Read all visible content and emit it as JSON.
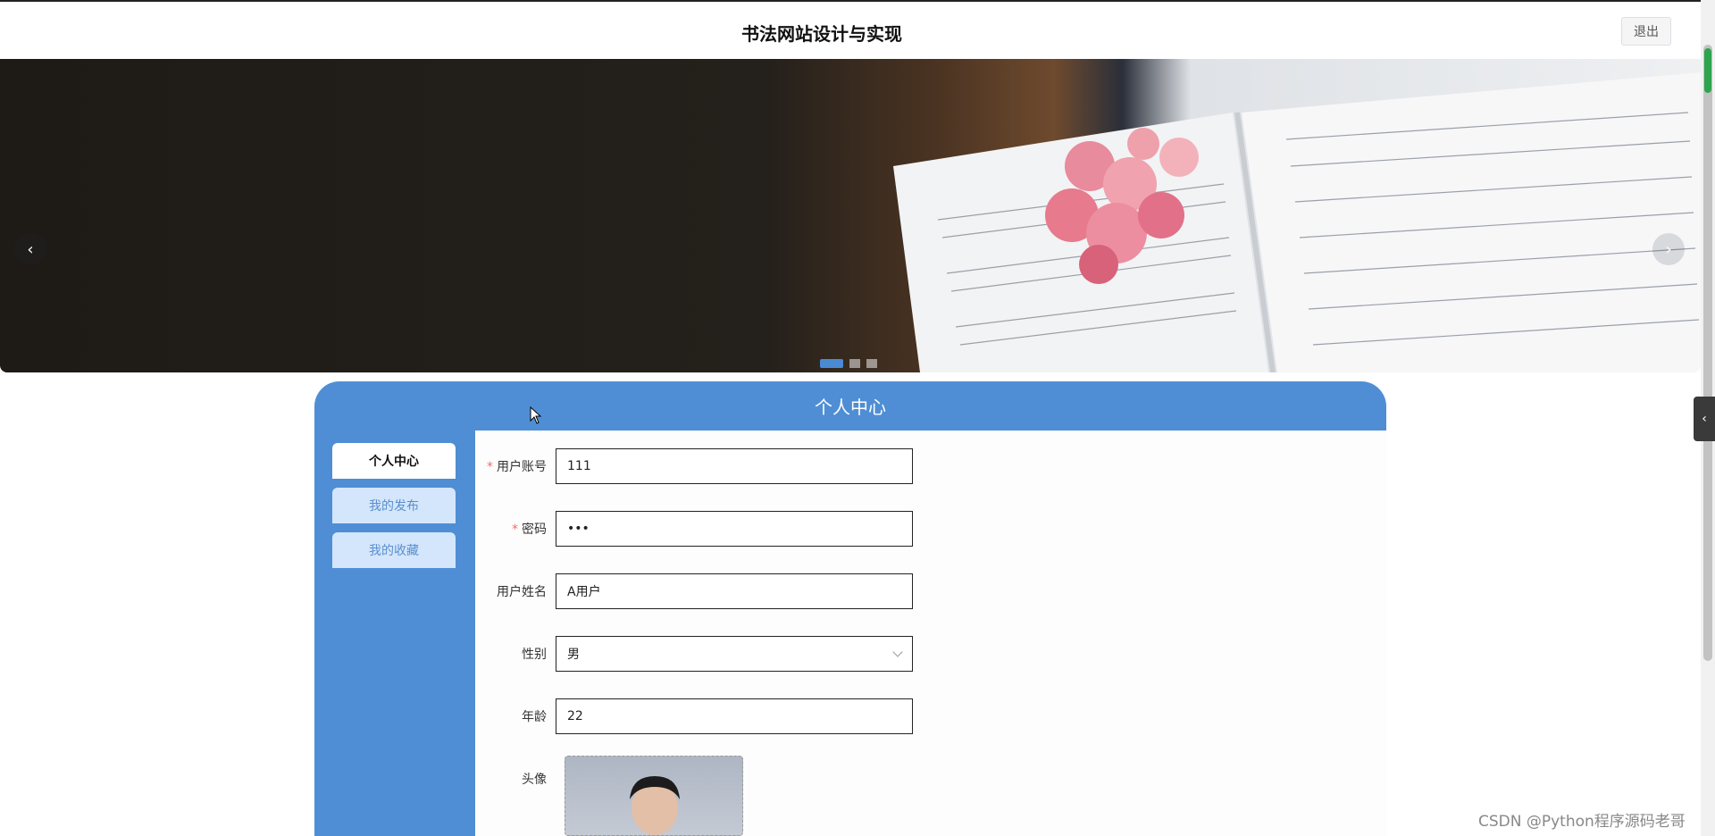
{
  "header": {
    "title": "书法网站设计与实现",
    "logout_label": "退出"
  },
  "banner": {
    "prev_label": "‹",
    "next_label": "›"
  },
  "panel": {
    "title": "个人中心"
  },
  "sidebar": {
    "items": [
      {
        "label": "个人中心"
      },
      {
        "label": "我的发布"
      },
      {
        "label": "我的收藏"
      }
    ]
  },
  "form": {
    "account": {
      "label": "用户账号",
      "value": "111"
    },
    "password": {
      "label": "密码",
      "value": "•••"
    },
    "name": {
      "label": "用户姓名",
      "value": "A用户"
    },
    "gender": {
      "label": "性别",
      "value": "男"
    },
    "age": {
      "label": "年龄",
      "value": "22"
    },
    "avatar": {
      "label": "头像"
    },
    "required_mark": "*"
  },
  "side_toggle": {
    "label": "‹"
  },
  "watermark": "CSDN @Python程序源码老哥",
  "colors": {
    "accent": "#4f8ed4",
    "required": "#f56c6c",
    "sidebar_inactive": "#d4e6fb"
  }
}
